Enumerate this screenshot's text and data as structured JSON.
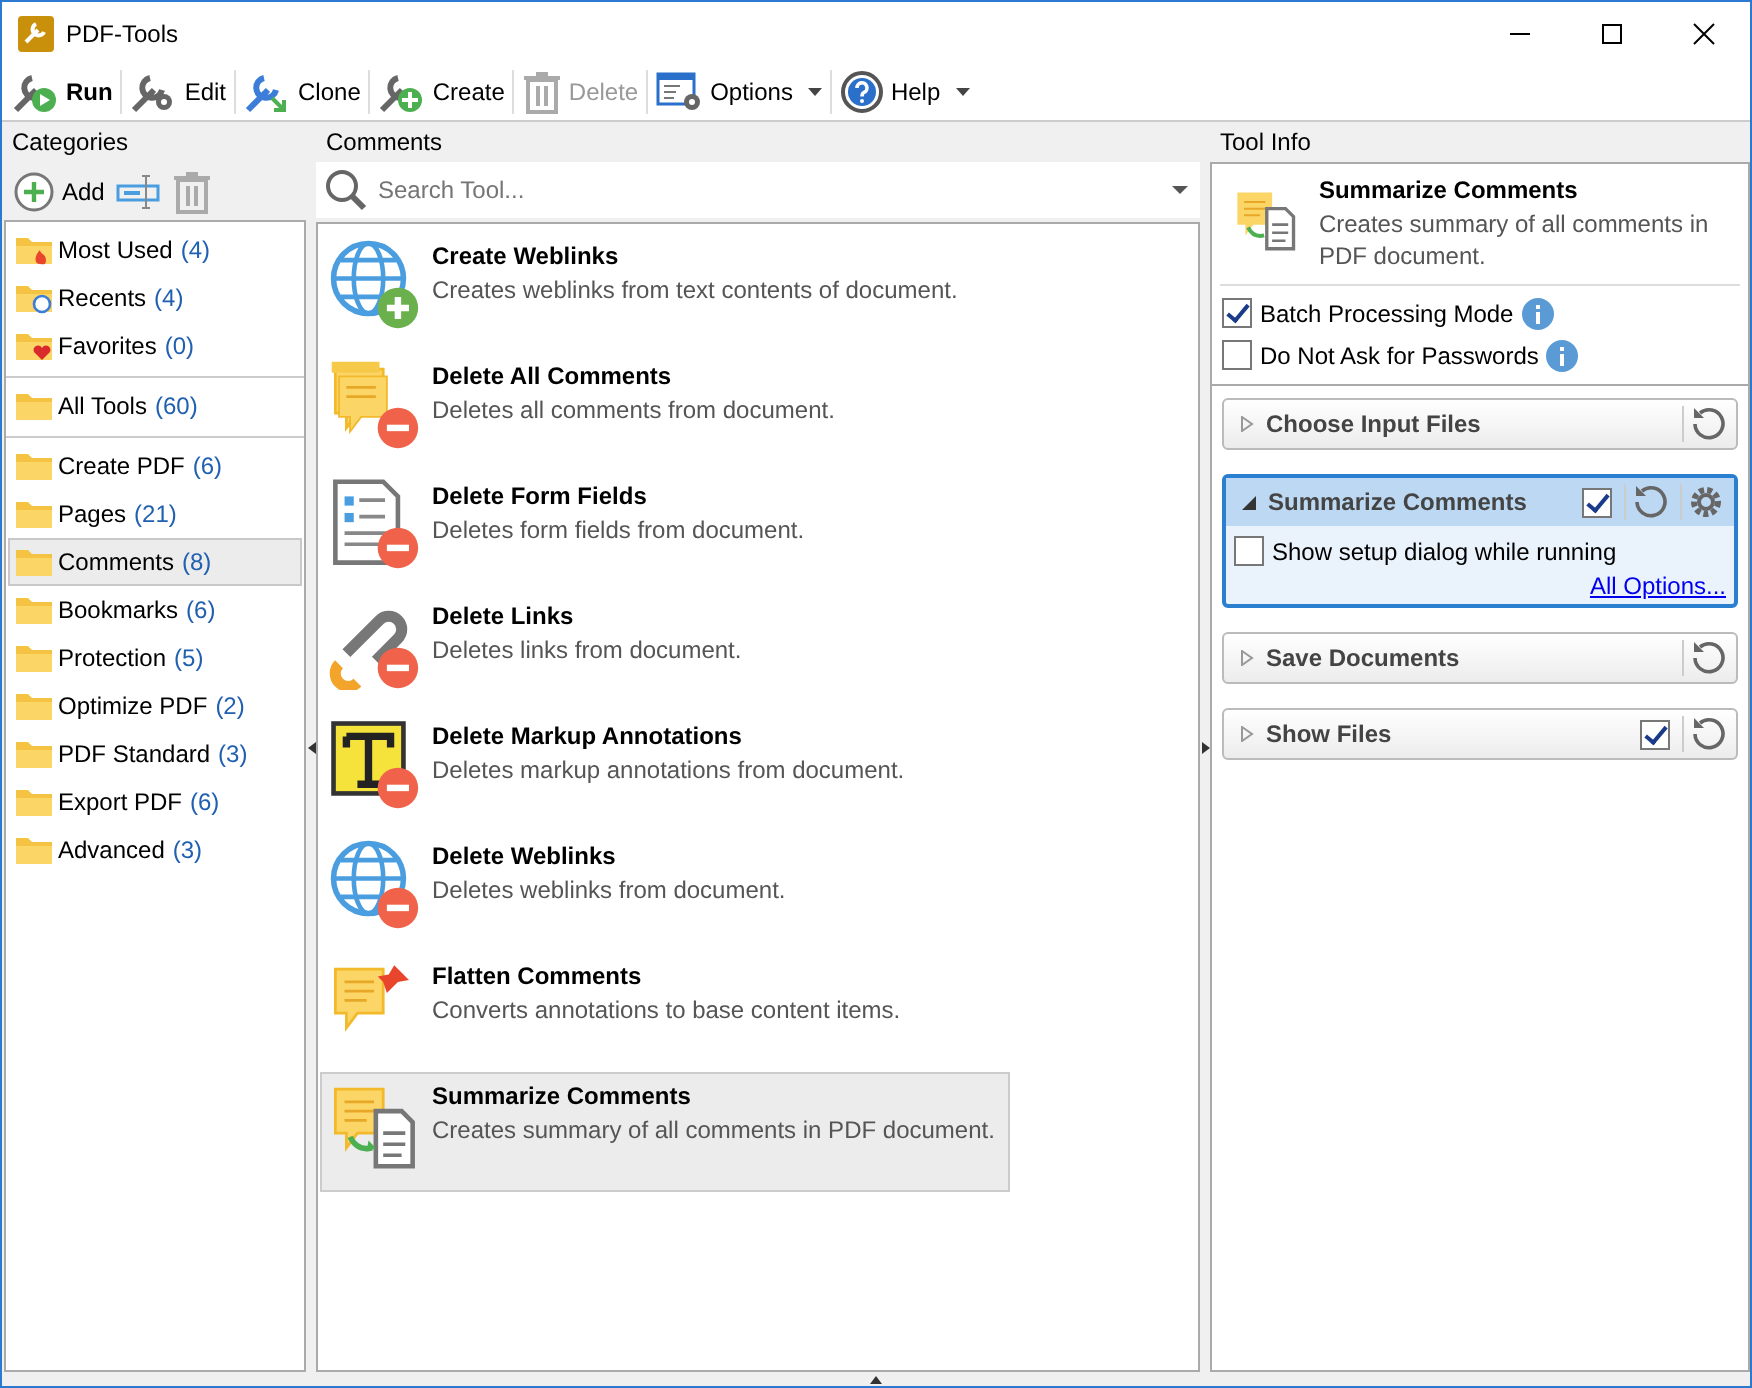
{
  "window": {
    "title": "PDF-Tools"
  },
  "toolbar": [
    {
      "label": "Run",
      "default": true,
      "disabled": false,
      "menu": false
    },
    {
      "label": "Edit",
      "default": false,
      "disabled": false,
      "menu": false
    },
    {
      "label": "Clone",
      "default": false,
      "disabled": false,
      "menu": false
    },
    {
      "label": "Create",
      "default": false,
      "disabled": false,
      "menu": false
    },
    {
      "label": "Delete",
      "default": false,
      "disabled": true,
      "menu": false
    },
    {
      "label": "Options",
      "default": false,
      "disabled": false,
      "menu": true
    },
    {
      "label": "Help",
      "default": false,
      "disabled": false,
      "menu": true
    }
  ],
  "categories": {
    "title": "Categories",
    "add_label": "Add",
    "groups": [
      {
        "items": [
          {
            "name": "Most Used",
            "count": "(4)",
            "selected": false
          },
          {
            "name": "Recents",
            "count": "(4)",
            "selected": false
          },
          {
            "name": "Favorites",
            "count": "(0)",
            "selected": false
          }
        ]
      },
      {
        "items": [
          {
            "name": "All Tools",
            "count": "(60)",
            "selected": false
          }
        ]
      },
      {
        "items": [
          {
            "name": "Create PDF",
            "count": "(6)",
            "selected": false
          },
          {
            "name": "Pages",
            "count": "(21)",
            "selected": false
          },
          {
            "name": "Comments",
            "count": "(8)",
            "selected": true
          },
          {
            "name": "Bookmarks",
            "count": "(6)",
            "selected": false
          },
          {
            "name": "Protection",
            "count": "(5)",
            "selected": false
          },
          {
            "name": "Optimize PDF",
            "count": "(2)",
            "selected": false
          },
          {
            "name": "PDF Standard",
            "count": "(3)",
            "selected": false
          },
          {
            "name": "Export PDF",
            "count": "(6)",
            "selected": false
          },
          {
            "name": "Advanced",
            "count": "(3)",
            "selected": false
          }
        ]
      }
    ]
  },
  "tools": {
    "title": "Comments",
    "search": {
      "placeholder": "Search Tool..."
    },
    "items": [
      {
        "name": "Create Weblinks",
        "description": "Creates weblinks from text contents of document.",
        "selected": false
      },
      {
        "name": "Delete All Comments",
        "description": "Deletes all comments from document.",
        "selected": false
      },
      {
        "name": "Delete Form Fields",
        "description": "Deletes form fields from document.",
        "selected": false
      },
      {
        "name": "Delete Links",
        "description": "Deletes links from document.",
        "selected": false
      },
      {
        "name": "Delete Markup Annotations",
        "description": "Deletes markup annotations from document.",
        "selected": false
      },
      {
        "name": "Delete Weblinks",
        "description": "Deletes weblinks from document.",
        "selected": false
      },
      {
        "name": "Flatten Comments",
        "description": "Converts annotations to base content items.",
        "selected": false
      },
      {
        "name": "Summarize Comments",
        "description": "Creates summary of all comments in PDF document.",
        "selected": true
      }
    ]
  },
  "tool_info": {
    "title": "Tool Info",
    "name": "Summarize Comments",
    "description": "Creates summary of all comments in PDF document.",
    "options": [
      {
        "label": "Batch Processing Mode",
        "checked": true
      },
      {
        "label": "Do Not Ask for Passwords",
        "checked": false
      }
    ],
    "steps": [
      {
        "title": "Choose Input Files",
        "expanded": false
      },
      {
        "title": "Summarize Comments",
        "expanded": true,
        "checked": true,
        "setting": {
          "label": "Show setup dialog while running",
          "checked": false
        },
        "link": "All Options..."
      },
      {
        "title": "Save Documents",
        "expanded": false
      },
      {
        "title": "Show Files",
        "expanded": false,
        "checked": true
      }
    ]
  }
}
